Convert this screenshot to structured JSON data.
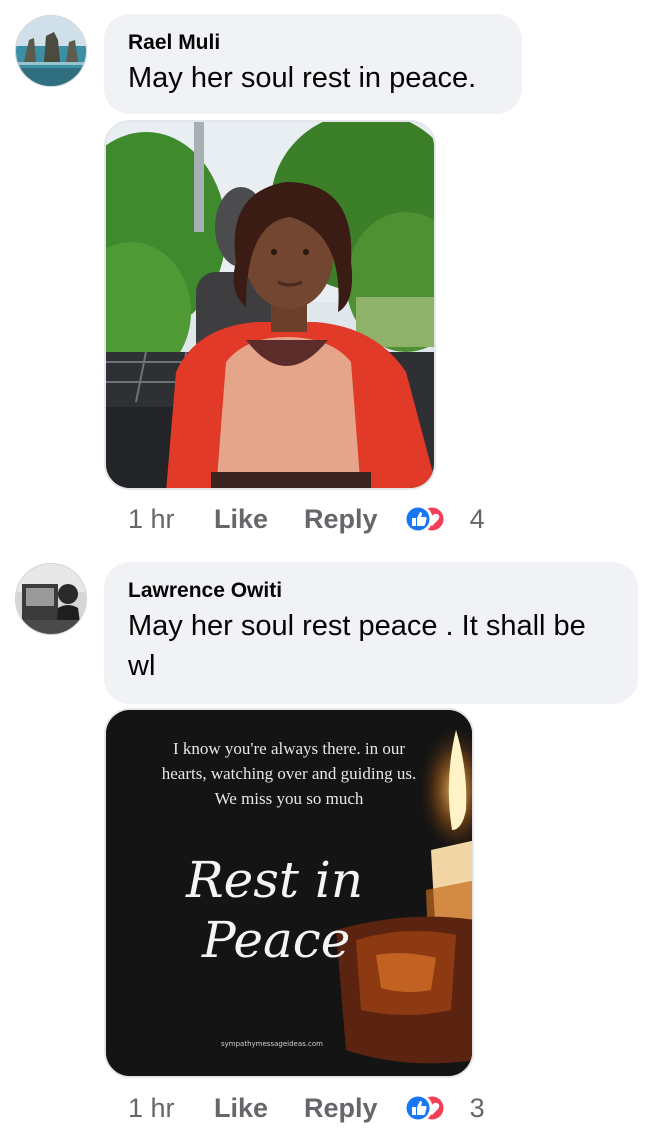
{
  "comments": [
    {
      "author": "Rael Muli",
      "text": "May her soul rest in peace.",
      "time": "1 hr",
      "like_label": "Like",
      "reply_label": "Reply",
      "reaction_count": "4",
      "reactions": [
        "like-icon",
        "love-icon"
      ]
    },
    {
      "author": "Lawrence Owiti",
      "text": "May her soul rest peace . It shall be wl",
      "time": "1 hr",
      "like_label": "Like",
      "reply_label": "Reply",
      "reaction_count": "3",
      "reactions": [
        "like-icon",
        "love-icon"
      ],
      "image": {
        "quote": "I know you're always there. in our hearts, watching over and guiding us. We miss you so much",
        "title_line1": "Rest in",
        "title_line2": "Peace",
        "site": "sympathymessageideas.com"
      }
    }
  ],
  "colors": {
    "bubble": "#f0f2f5",
    "meta_text": "#65676b",
    "like_blue": "#1877f2",
    "love_red": "#f33e58"
  }
}
